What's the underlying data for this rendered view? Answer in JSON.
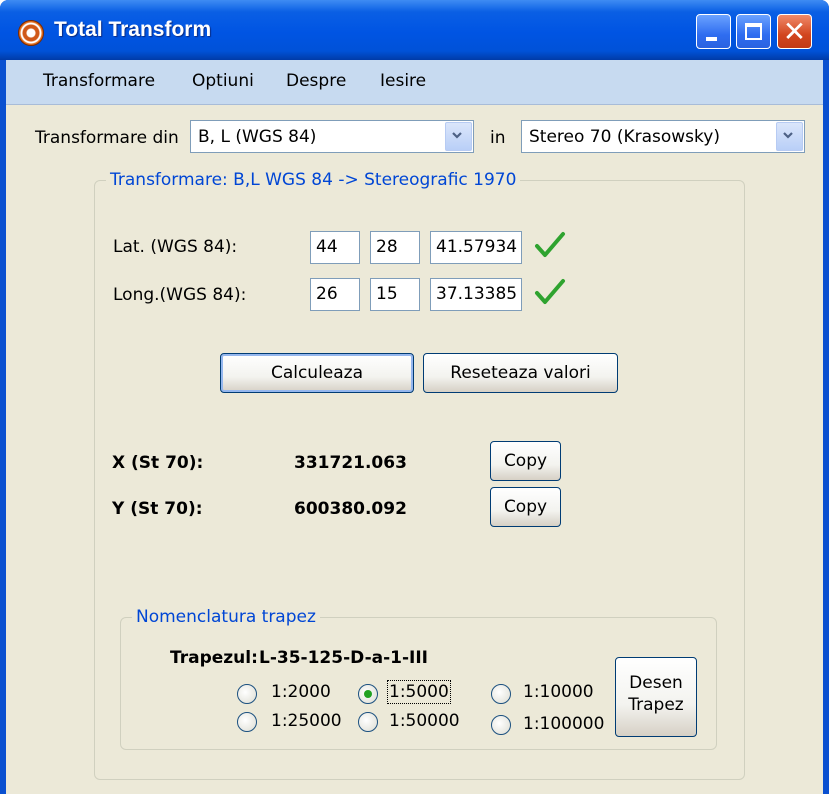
{
  "window": {
    "title": "Total Transform"
  },
  "menu": [
    "Transformare",
    "Optiuni",
    "Despre",
    "Iesire"
  ],
  "transform": {
    "from_label": "Transformare din",
    "from_value": "B, L (WGS 84)",
    "in_label": "in",
    "to_value": "Stereo 70 (Krasowsky)"
  },
  "group": {
    "title": "Transformare: B,L WGS 84 -> Stereografic 1970",
    "lat_label": "Lat. (WGS 84):",
    "lat": [
      "44",
      "28",
      "41.57934"
    ],
    "long_label": "Long.(WGS 84):",
    "long": [
      "26",
      "15",
      "37.13385"
    ],
    "calc_button": "Calculeaza",
    "reset_button": "Reseteaza valori",
    "x_label": "X (St 70):",
    "x_value": "331721.063",
    "y_label": "Y (St 70):",
    "y_value": "600380.092",
    "copy_label": "Copy"
  },
  "nomenclatura": {
    "title": "Nomenclatura trapez",
    "trapez_label": "Trapezul:",
    "trapez_value": "L-35-125-D-a-1-III",
    "scales": [
      {
        "label": "1:2000",
        "selected": false
      },
      {
        "label": "1:5000",
        "selected": true
      },
      {
        "label": "1:10000",
        "selected": false
      },
      {
        "label": "1:25000",
        "selected": false
      },
      {
        "label": "1:50000",
        "selected": false
      },
      {
        "label": "1:100000",
        "selected": false
      }
    ],
    "draw_button_line1": "Desen",
    "draw_button_line2": "Trapez"
  },
  "colors": {
    "titlebar": "#0054e3",
    "accent_text": "#0046d5",
    "check": "#2fa32f",
    "radio_selected": "#21a121"
  }
}
